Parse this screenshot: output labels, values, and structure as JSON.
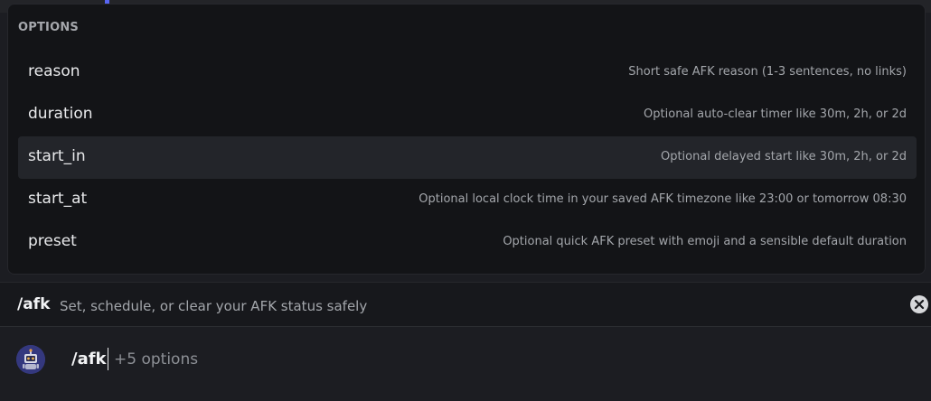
{
  "popup": {
    "header": "OPTIONS",
    "options": [
      {
        "name": "reason",
        "description": "Short safe AFK reason (1-3 sentences, no links)"
      },
      {
        "name": "duration",
        "description": "Optional auto-clear timer like 30m, 2h, or 2d"
      },
      {
        "name": "start_in",
        "description": "Optional delayed start like 30m, 2h, or 2d"
      },
      {
        "name": "start_at",
        "description": "Optional local clock time in your saved AFK timezone like 23:00 or tomorrow 08:30"
      },
      {
        "name": "preset",
        "description": "Optional quick AFK preset with emoji and a sensible default duration"
      }
    ],
    "selected_option": "start_in"
  },
  "command_bar": {
    "command": "/afk",
    "description": "Set, schedule, or clear your AFK status safely",
    "close_icon": "close-circle-icon"
  },
  "input": {
    "command": "/afk",
    "hint": "+5 options",
    "avatar_icon": "robot-avatar"
  },
  "colors": {
    "accent": "#5865f2",
    "popup_bg": "#131417",
    "selected_bg": "#23252a",
    "app_bg": "#1c1d22"
  }
}
